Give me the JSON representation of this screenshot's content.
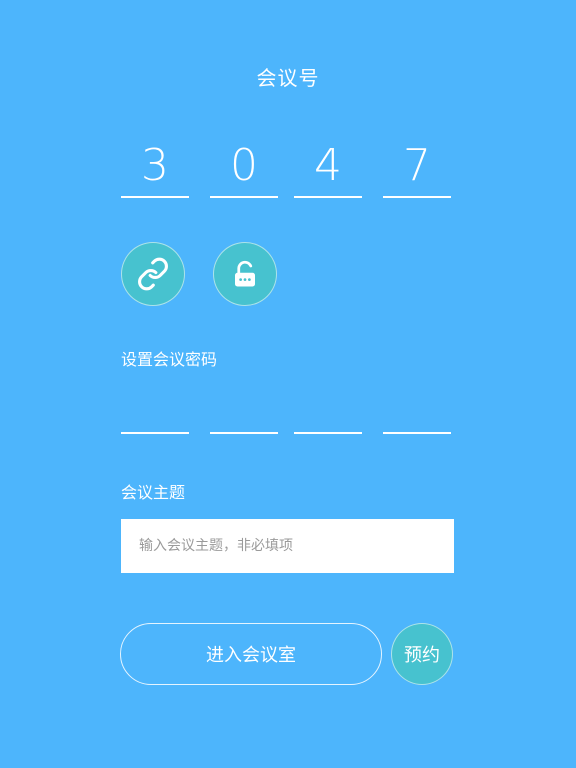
{
  "header": {
    "title": "会议号"
  },
  "meeting_number": {
    "digits": [
      "3",
      "0",
      "4",
      "7"
    ]
  },
  "action_icons": {
    "link": "link-icon",
    "lock": "unlock-icon"
  },
  "password": {
    "label": "设置会议密码",
    "digits": [
      "",
      "",
      "",
      ""
    ]
  },
  "topic": {
    "label": "会议主题",
    "placeholder": "输入会议主题，非必填项",
    "value": ""
  },
  "buttons": {
    "enter_label": "进入会议室",
    "reserve_label": "预约"
  },
  "colors": {
    "background": "#4db5fc",
    "accent": "#47c2cf",
    "input_bg": "#ffffff"
  }
}
